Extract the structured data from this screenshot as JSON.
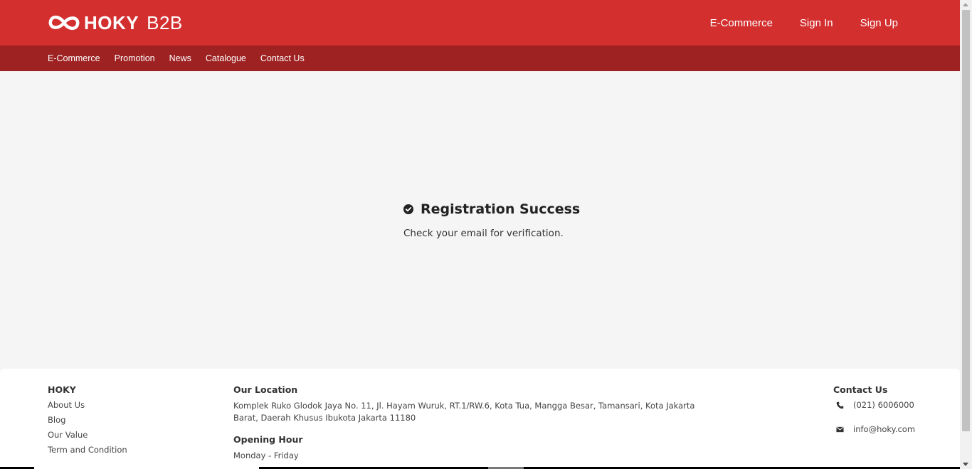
{
  "header": {
    "logo_text": "HOKY",
    "logo_suffix": "B2B",
    "top_links": [
      "E-Commerce",
      "Sign In",
      "Sign Up"
    ],
    "brand_color": "#d32f2f",
    "subnav_color": "#9e2222"
  },
  "subnav": {
    "items": [
      "E-Commerce",
      "Promotion",
      "News",
      "Catalogue",
      "Contact Us"
    ]
  },
  "main": {
    "icon": "check-circle-icon",
    "title": "Registration Success",
    "message": "Check your email for verification."
  },
  "footer": {
    "brand": {
      "heading": "HOKY",
      "links": [
        "About Us",
        "Blog",
        "Our Value",
        "Term and Condition"
      ]
    },
    "location": {
      "heading": "Our Location",
      "address": "Komplek Ruko Glodok Jaya No. 11, Jl. Hayam Wuruk, RT.1/RW.6, Kota Tua, Mangga Besar, Tamansari, Kota Jakarta Barat, Daerah Khusus Ibukota Jakarta 11180"
    },
    "hours": {
      "heading": "Opening Hour",
      "days": "Monday - Friday"
    },
    "contact": {
      "heading": "Contact Us",
      "phone": "(021) 6006000",
      "email": "info@hoky.com",
      "phone_icon": "phone-icon",
      "email_icon": "mail-icon"
    }
  }
}
